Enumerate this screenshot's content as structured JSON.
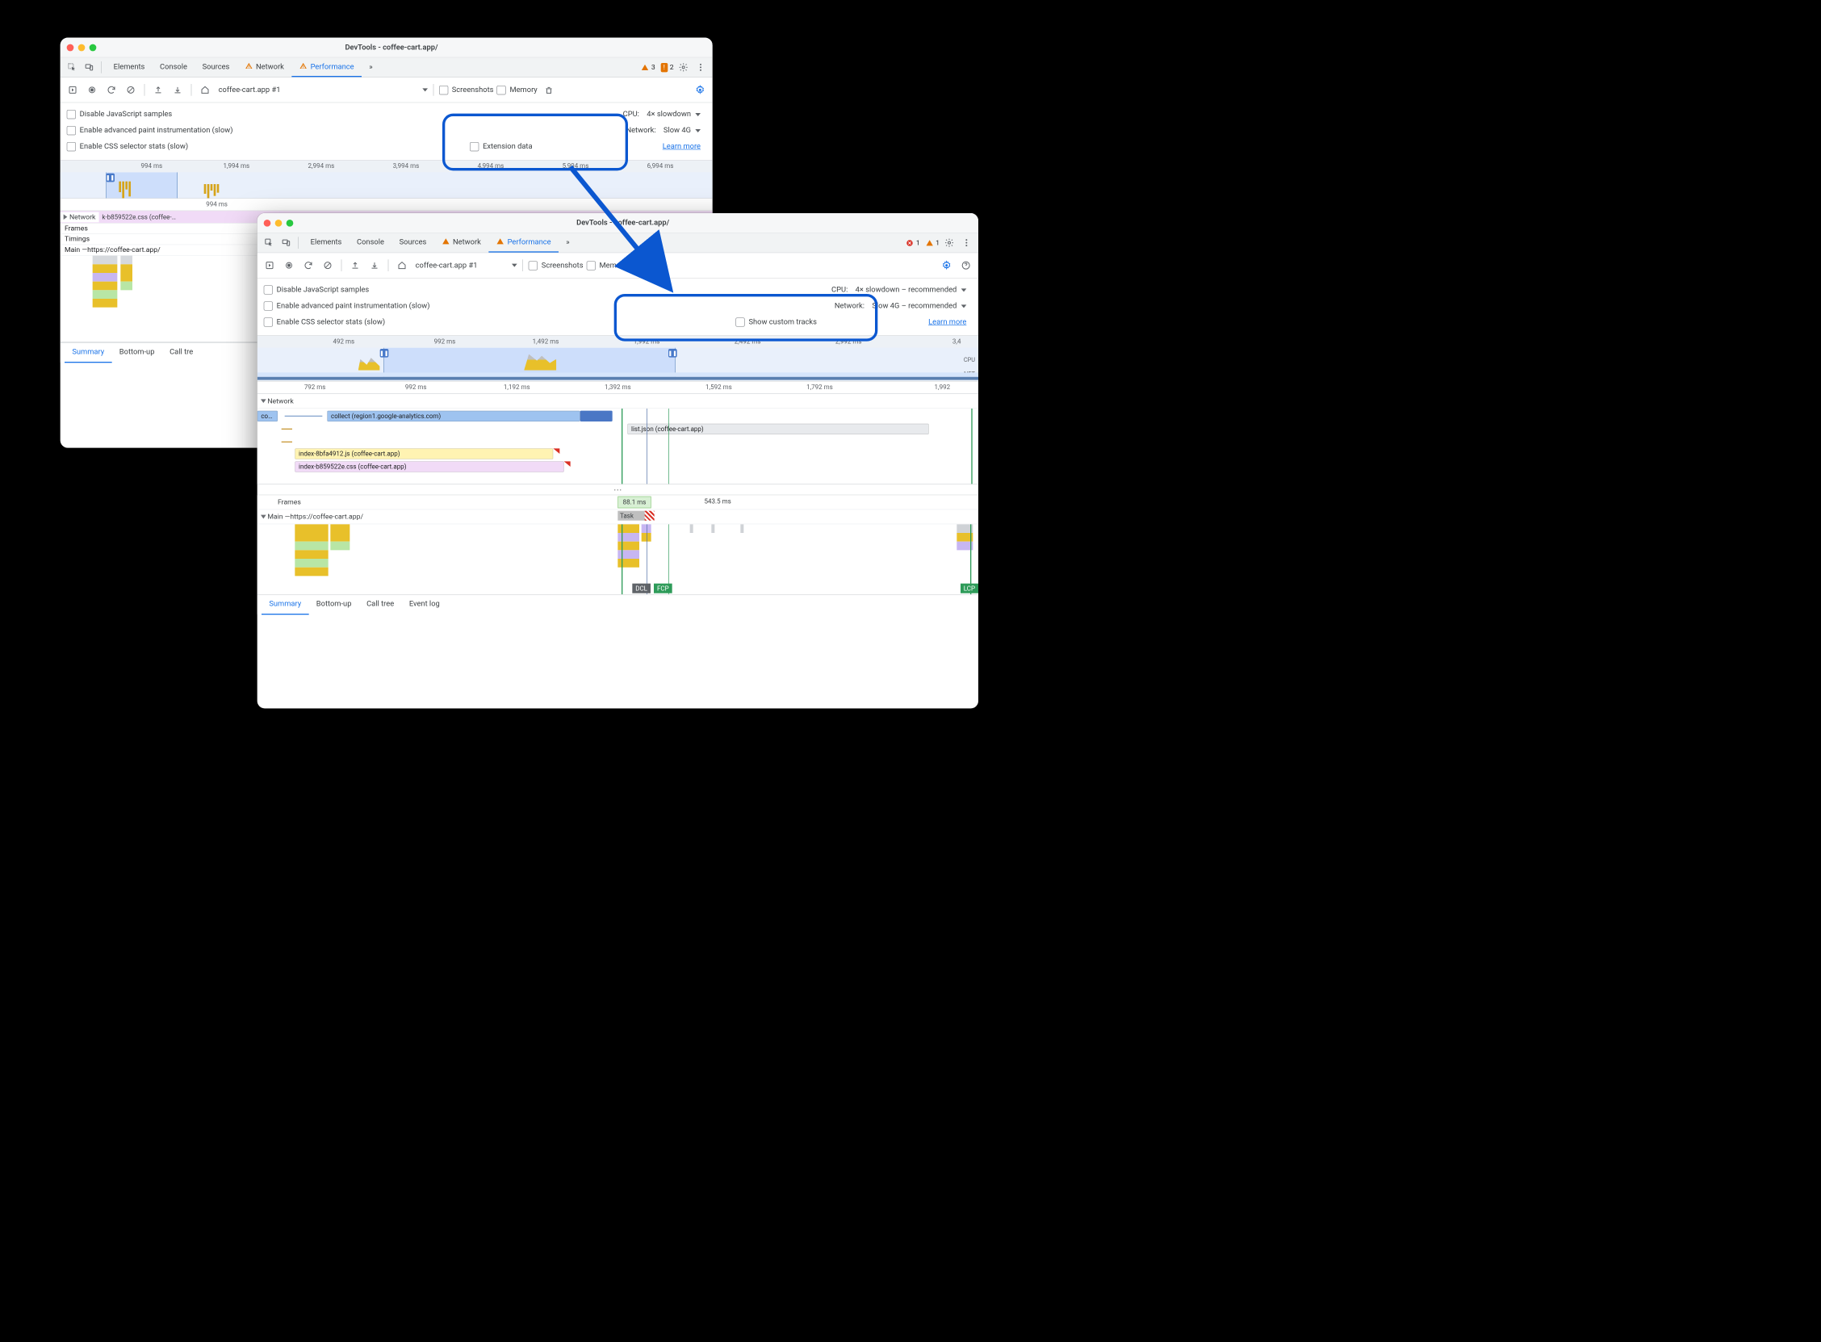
{
  "titles": {
    "win1": "DevTools - coffee-cart.app/",
    "win2": "DevTools - coffee-cart.app/"
  },
  "tabs": {
    "elements": "Elements",
    "console": "Console",
    "sources": "Sources",
    "network": "Network",
    "performance": "Performance",
    "more": "»"
  },
  "badges": {
    "win1_warn_tri": "3",
    "win1_warn_box": "2",
    "win2_err": "1",
    "win2_warn_tri": "1"
  },
  "toolbar": {
    "profile_name": "coffee-cart.app #1",
    "screenshots": "Screenshots",
    "memory": "Memory"
  },
  "settings": {
    "js_samples": "Disable JavaScript samples",
    "paint_instr": "Enable advanced paint instrumentation (slow)",
    "css_stats": "Enable CSS selector stats (slow)",
    "cpu_label": "CPU:",
    "cpu_val_1": "4× slowdown",
    "cpu_val_2": "4× slowdown – recommended",
    "net_label": "Network:",
    "net_val_1": "Slow 4G",
    "net_val_2": "Slow 4G – recommended",
    "ext_data": "Extension data",
    "custom_tracks": "Show custom tracks",
    "learn_more": "Learn more"
  },
  "overview1": {
    "ticks": [
      "994 ms",
      "1,994 ms",
      "2,994 ms",
      "3,994 ms",
      "4,994 ms",
      "5,994 ms",
      "6,994 ms"
    ]
  },
  "overview2": {
    "ticks": [
      "492 ms",
      "992 ms",
      "1,492 ms",
      "1,992 ms",
      "2,492 ms",
      "2,992 ms",
      "3,4"
    ],
    "cpu_label": "CPU",
    "net_label": "NET"
  },
  "ruler1_single": "994 ms",
  "ruler2": [
    "792 ms",
    "992 ms",
    "1,192 ms",
    "1,392 ms",
    "1,592 ms",
    "1,792 ms",
    "1,992"
  ],
  "tracks": {
    "network": "Network",
    "frames": "Frames",
    "timings": "Timings",
    "main_prefix": "Main — ",
    "main_url": "https://coffee-cart.app/"
  },
  "net1_bar": "k-b859522e.css (coffee-…",
  "net1_bar_prefix": "Network",
  "net_bars2": {
    "co": "co…",
    "collect": "collect (region1.google-analytics.com)",
    "listjson": "list.json (coffee-cart.app)",
    "indexjs": "index-8bfa4912.js (coffee-cart.app)",
    "indexcss": "index-b859522e.css (coffee-cart.app)"
  },
  "frames2": {
    "f1": "88.1 ms",
    "f2": "543.5 ms"
  },
  "task_label": "Task",
  "markers": {
    "dcl": "DCL",
    "fcp": "FCP",
    "lcp": "LCP"
  },
  "ellipsis": "⋯",
  "bottom_tabs": {
    "summary": "Summary",
    "bottomup": "Bottom-up",
    "calltree": "Call tree",
    "calltree_trunc": "Call tre",
    "eventlog": "Event log"
  }
}
